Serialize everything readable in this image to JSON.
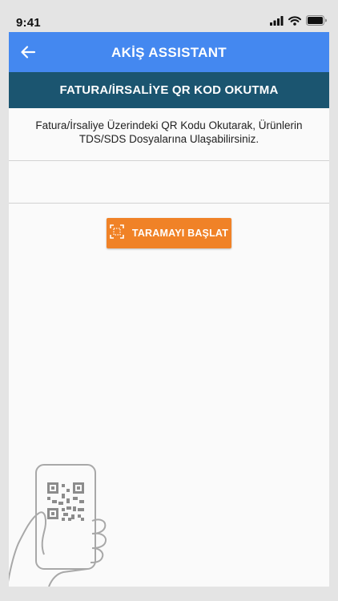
{
  "status_bar": {
    "time": "9:41",
    "icons": [
      "cellular-signal-icon",
      "wifi-icon",
      "battery-icon"
    ]
  },
  "app_bar": {
    "title": "AKİŞ ASSISTANT",
    "back_icon": "arrow-left-icon",
    "color": "#4488f0"
  },
  "section_header": {
    "title": "FATURA/İRSALİYE QR KOD OKUTMA",
    "color": "#1b5570"
  },
  "description": {
    "line1": "Fatura/İrsaliye Üzerindeki QR Kodu Okutarak, Ürünlerin",
    "line2": "TDS/SDS Dosyalarına Ulaşabilirsiniz."
  },
  "scan_button": {
    "label": "TARAMAYI BAŞLAT",
    "icon": "scan-frame-icon",
    "color": "#f08227"
  },
  "illustration": {
    "icon": "hand-holding-phone-qr-icon"
  }
}
